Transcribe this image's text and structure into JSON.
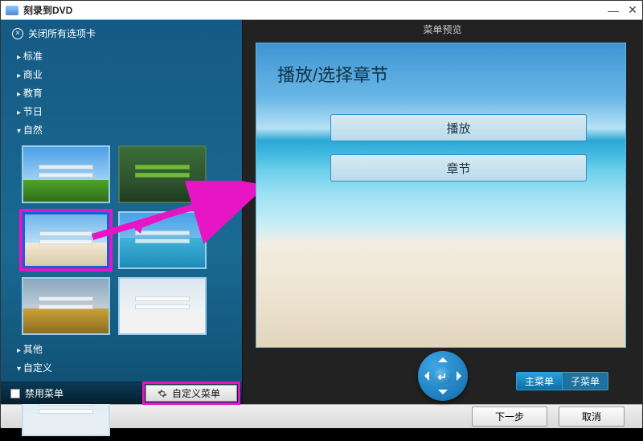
{
  "window": {
    "title": "刻录到DVD"
  },
  "sidebar": {
    "close_all": "关闭所有选项卡",
    "cats": {
      "standard": "标准",
      "business": "商业",
      "education": "教育",
      "holiday": "节日",
      "nature": "自然",
      "other": "其他",
      "custom": "自定义"
    },
    "disable_menu": "禁用菜单",
    "custom_menu_btn": "自定义菜单"
  },
  "preview": {
    "header": "菜单预览",
    "title": "播放/选择章节",
    "play": "播放",
    "chapters": "章节",
    "tab_main": "主菜单",
    "tab_sub": "子菜单"
  },
  "footer": {
    "next": "下一步",
    "cancel": "取消"
  }
}
